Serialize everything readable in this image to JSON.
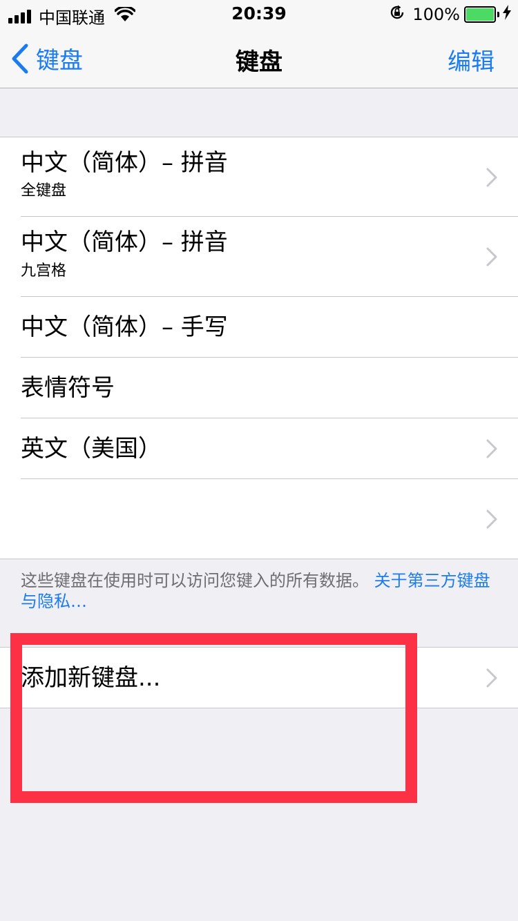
{
  "status_bar": {
    "carrier": "中国联通",
    "time": "20:39",
    "battery": "100%",
    "battery_level": 1.0,
    "icons": [
      "signal-icon",
      "wifi-icon",
      "orientation-lock-icon",
      "battery-icon",
      "charging-bolt-icon"
    ]
  },
  "nav": {
    "back_label": "键盘",
    "title": "键盘",
    "edit_label": "编辑"
  },
  "keyboards": [
    {
      "title": "中文（简体）– 拼音",
      "subtitle": "全键盘",
      "chevron": true
    },
    {
      "title": "中文（简体）– 拼音",
      "subtitle": "九宫格",
      "chevron": true
    },
    {
      "title": "中文（简体）– 手写",
      "subtitle": "",
      "chevron": false
    },
    {
      "title": "表情符号",
      "subtitle": "",
      "chevron": false
    },
    {
      "title": "英文（美国）",
      "subtitle": "",
      "chevron": true
    },
    {
      "title": "",
      "subtitle": "",
      "chevron": true
    }
  ],
  "footer": {
    "note": "这些键盘在使用时可以访问您键入的所有数据。",
    "link": "关于第三方键盘与隐私…"
  },
  "add_keyboard": {
    "label": "添加新键盘..."
  },
  "colors": {
    "accent": "#1b7cf0",
    "highlight": "#fc3145",
    "battery": "#4cd964",
    "background": "#efeff4"
  }
}
